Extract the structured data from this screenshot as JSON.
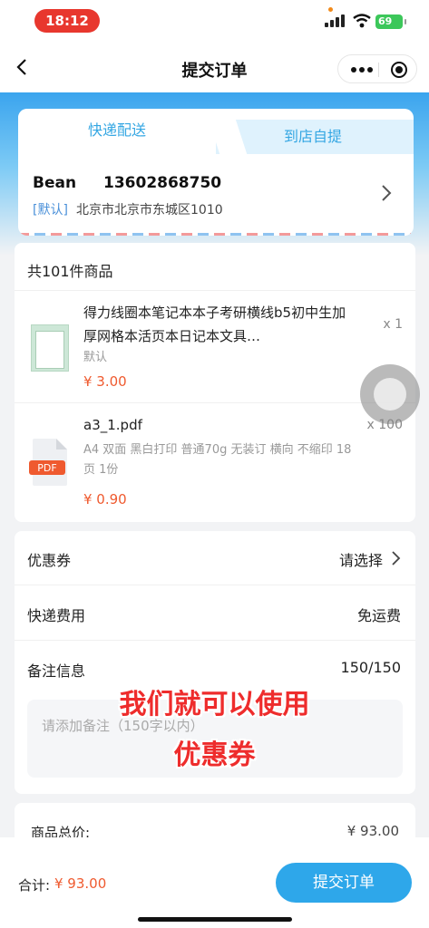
{
  "status_bar": {
    "time": "18:12",
    "battery": "69"
  },
  "nav": {
    "title": "提交订单"
  },
  "delivery": {
    "tabs": [
      {
        "label": "快递配送",
        "active": true
      },
      {
        "label": "到店自提",
        "active": false
      }
    ],
    "name": "Bean",
    "phone": "13602868750",
    "default_tag": "[默认]",
    "address": "北京市北京市东城区1010"
  },
  "goods": {
    "count_label": "共101件商品",
    "items": [
      {
        "title": "得力线圈本笔记本本子考研横线b5初中生加厚网格本活页本日记本文具…",
        "qty": "x 1",
        "spec": "默认",
        "price": "¥ 3.00",
        "icon": "notebook-thumbnail"
      },
      {
        "title": "a3_1.pdf",
        "qty": "x 100",
        "spec": "A4 双面 黑白打印 普通70g 无装订 横向 不缩印 18页 1份",
        "price": "¥ 0.90",
        "icon": "pdf-icon",
        "badge": "PDF"
      }
    ]
  },
  "options": {
    "coupon": {
      "label": "优惠券",
      "value": "请选择"
    },
    "shipping": {
      "label": "快递费用",
      "value": "免运费"
    },
    "remark": {
      "label": "备注信息",
      "counter": "150/150",
      "placeholder": "请添加备注（150字以内）"
    }
  },
  "overlay_caption": {
    "line1": "我们就可以使用",
    "line2": "优惠券"
  },
  "summary": {
    "label": "商品总价:",
    "value": "¥ 93.00"
  },
  "footer": {
    "total_label": "合计:",
    "total_value": "¥ 93.00",
    "submit_label": "提交订单"
  },
  "colors": {
    "accent": "#2ea7ea",
    "price": "#ef5a2f",
    "caption": "#ee2c2c"
  }
}
